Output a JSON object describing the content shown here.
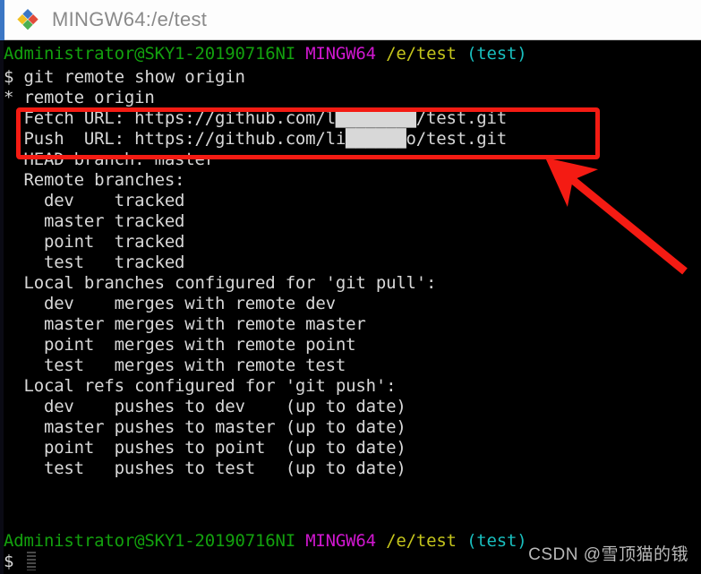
{
  "window": {
    "title": "MINGW64:/e/test",
    "icon": "mingw-diamond-icon",
    "accent_color": "#3b76c4",
    "titlebar_bg": "#fdfdfd",
    "title_color": "#8a8a8a"
  },
  "terminal": {
    "background": "#000000",
    "foreground": "#d6d6d6",
    "colors": {
      "user_host": "#13a10e",
      "shell": "#d017cf",
      "path": "#c5c51c",
      "branch": "#19bfbf",
      "text": "#d8d8d8"
    },
    "prompt_top": {
      "user_host": "Administrator@SKY1-20190716NI",
      "shell": "MINGW64",
      "path": "/e/test",
      "branch": "(test)"
    },
    "command_line": "$ git remote show origin",
    "output": [
      "* remote origin",
      "  Fetch URL: https://github.com/l████████/test.git",
      "  Push  URL: https://github.com/li██████o/test.git",
      "  HEAD branch: master",
      "  Remote branches:",
      "    dev    tracked",
      "    master tracked",
      "    point  tracked",
      "    test   tracked",
      "  Local branches configured for 'git pull':",
      "    dev    merges with remote dev",
      "    master merges with remote master",
      "    point  merges with remote point",
      "    test   merges with remote test",
      "  Local refs configured for 'git push':",
      "    dev    pushes to dev    (up to date)",
      "    master pushes to master (up to date)",
      "    point  pushes to point  (up to date)",
      "    test   pushes to test   (up to date)"
    ],
    "prompt_bottom": {
      "user_host": "Administrator@SKY1-20190716NI",
      "shell": "MINGW64",
      "path": "/e/test",
      "branch": "(test)"
    },
    "prompt_symbol": "$"
  },
  "annotations": {
    "highlight_box": {
      "label": "fetch-push-url-highlight",
      "color": "#f41b13",
      "covers": "Fetch URL / Push URL lines"
    },
    "arrow": {
      "label": "pointer-arrow",
      "color": "#f41b13",
      "direction": "points up-left to highlight box"
    }
  },
  "watermark": {
    "text": "CSDN @雪顶猫的锇"
  }
}
